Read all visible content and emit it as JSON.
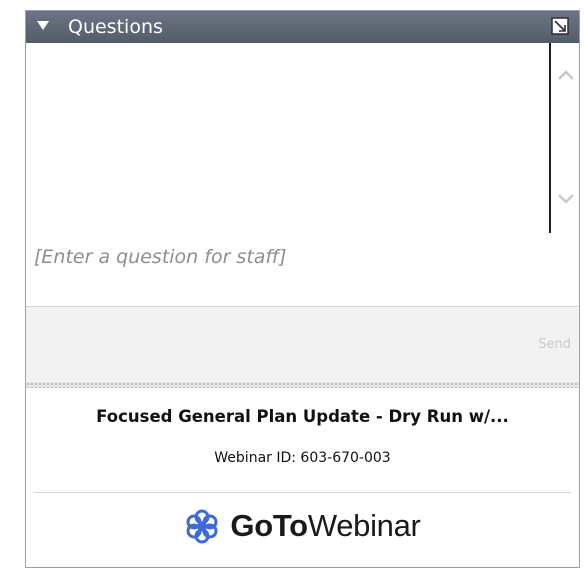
{
  "panel": {
    "title": "Questions",
    "collapse_icon": "triangle-down-icon",
    "popout_icon": "popout-icon"
  },
  "questions": {
    "input_placeholder": "[Enter a question for staff]",
    "input_value": "",
    "send_label": "Send"
  },
  "webinar": {
    "title": "Focused General Plan Update - Dry Run w/...",
    "id_text": "Webinar ID: 603-670-003"
  },
  "brand": {
    "goto": "GoTo",
    "webinar": "Webinar",
    "logo_color": "#3d6ad6"
  }
}
